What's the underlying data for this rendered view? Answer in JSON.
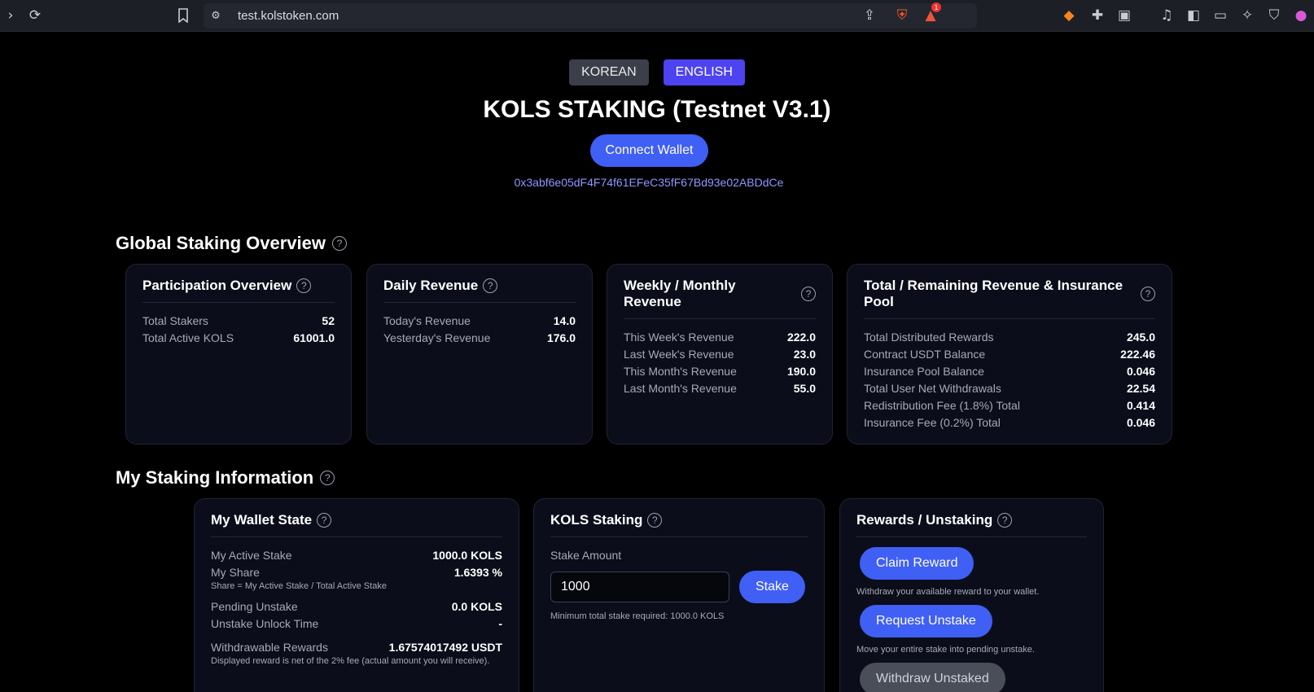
{
  "browser": {
    "url": "test.kolstoken.com",
    "alert_count": "1"
  },
  "header": {
    "lang_korean": "KOREAN",
    "lang_english": "ENGLISH",
    "title": "KOLS STAKING (Testnet V3.1)",
    "connect_label": "Connect Wallet",
    "wallet_address": "0x3abf6e05dF4F74f61EFeC35fF67Bd93e02ABDdCe"
  },
  "global": {
    "title": "Global Staking Overview",
    "participation": {
      "title": "Participation Overview",
      "rows": [
        {
          "k": "Total Stakers",
          "v": "52"
        },
        {
          "k": "Total Active KOLS",
          "v": "61001.0"
        }
      ]
    },
    "daily": {
      "title": "Daily Revenue",
      "rows": [
        {
          "k": "Today's Revenue",
          "v": "14.0"
        },
        {
          "k": "Yesterday's Revenue",
          "v": "176.0"
        }
      ]
    },
    "weekly": {
      "title": "Weekly / Monthly Revenue",
      "rows": [
        {
          "k": "This Week's Revenue",
          "v": "222.0"
        },
        {
          "k": "Last Week's Revenue",
          "v": "23.0"
        },
        {
          "k": "This Month's Revenue",
          "v": "190.0"
        },
        {
          "k": "Last Month's Revenue",
          "v": "55.0"
        }
      ]
    },
    "total": {
      "title_line1": "Total / Remaining Revenue & Insurance",
      "title_line2": "Pool",
      "rows": [
        {
          "k": "Total Distributed Rewards",
          "v": "245.0"
        },
        {
          "k": "Contract USDT Balance",
          "v": "222.46"
        },
        {
          "k": "Insurance Pool Balance",
          "v": "0.046"
        },
        {
          "k": "Total User Net Withdrawals",
          "v": "22.54"
        },
        {
          "k": "Redistribution Fee (1.8%) Total",
          "v": "0.414"
        },
        {
          "k": "Insurance Fee (0.2%) Total",
          "v": "0.046"
        }
      ]
    }
  },
  "mine": {
    "title": "My Staking Information",
    "wallet": {
      "title": "My Wallet State",
      "active_stake_k": "My Active Stake",
      "active_stake_v": "1000.0 KOLS",
      "share_k": "My Share",
      "share_v": "1.6393 %",
      "share_note": "Share = My Active Stake / Total Active Stake",
      "pending_k": "Pending Unstake",
      "pending_v": "0.0 KOLS",
      "unlock_k": "Unstake Unlock Time",
      "unlock_v": "-",
      "withdrawable_k": "Withdrawable Rewards",
      "withdrawable_v": "1.67574017492 USDT",
      "fee_note": "Displayed reward is net of the 2% fee (actual amount you will receive)."
    },
    "staking": {
      "title": "KOLS Staking",
      "amount_label": "Stake Amount",
      "amount_value": "1000",
      "stake_label": "Stake",
      "min_note": "Minimum total stake required: 1000.0 KOLS"
    },
    "rewards": {
      "title": "Rewards / Unstaking",
      "claim_label": "Claim Reward",
      "claim_note": "Withdraw your available reward to your wallet.",
      "unstake_label": "Request Unstake",
      "unstake_note": "Move your entire stake into pending unstake.",
      "withdraw_label": "Withdraw Unstaked"
    }
  }
}
